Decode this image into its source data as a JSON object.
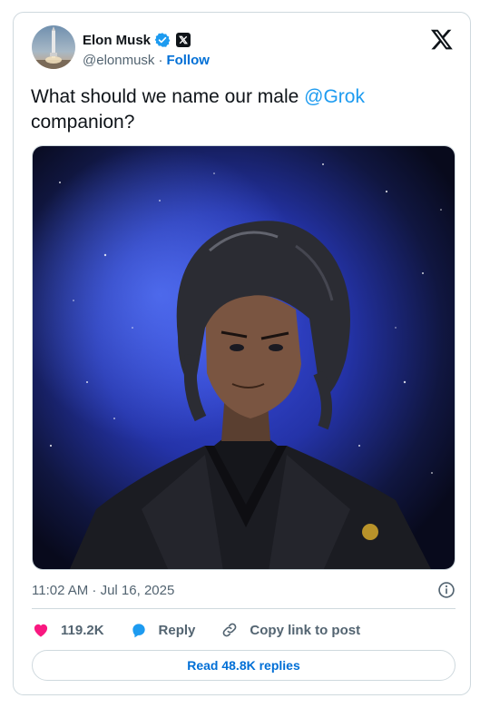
{
  "author": {
    "name": "Elon Musk",
    "handle": "@elonmusk",
    "separator": "·",
    "follow_label": "Follow"
  },
  "tweet": {
    "text_before_mention": "What should we name our male ",
    "mention": "@Grok",
    "text_after_mention": "companion?",
    "image_alt": "Anime-style illustration of a dark-haired young man in a black suit against a starry blue space background"
  },
  "meta": {
    "timestamp": "11:02 AM · Jul 16, 2025"
  },
  "actions": {
    "likes_count": "119.2K",
    "reply_label": "Reply",
    "copy_label": "Copy link to post"
  },
  "footer": {
    "read_replies_label": "Read 48.8K replies"
  },
  "colors": {
    "link_blue": "#1d9bf0",
    "follow_blue": "#006fd6",
    "like_pink": "#f91880",
    "muted": "#536471",
    "border": "#cfd9de"
  },
  "icons": [
    "verified-badge-icon",
    "x-affiliate-badge-icon",
    "x-logo-icon",
    "info-icon",
    "heart-icon",
    "reply-bubble-icon",
    "link-icon"
  ]
}
